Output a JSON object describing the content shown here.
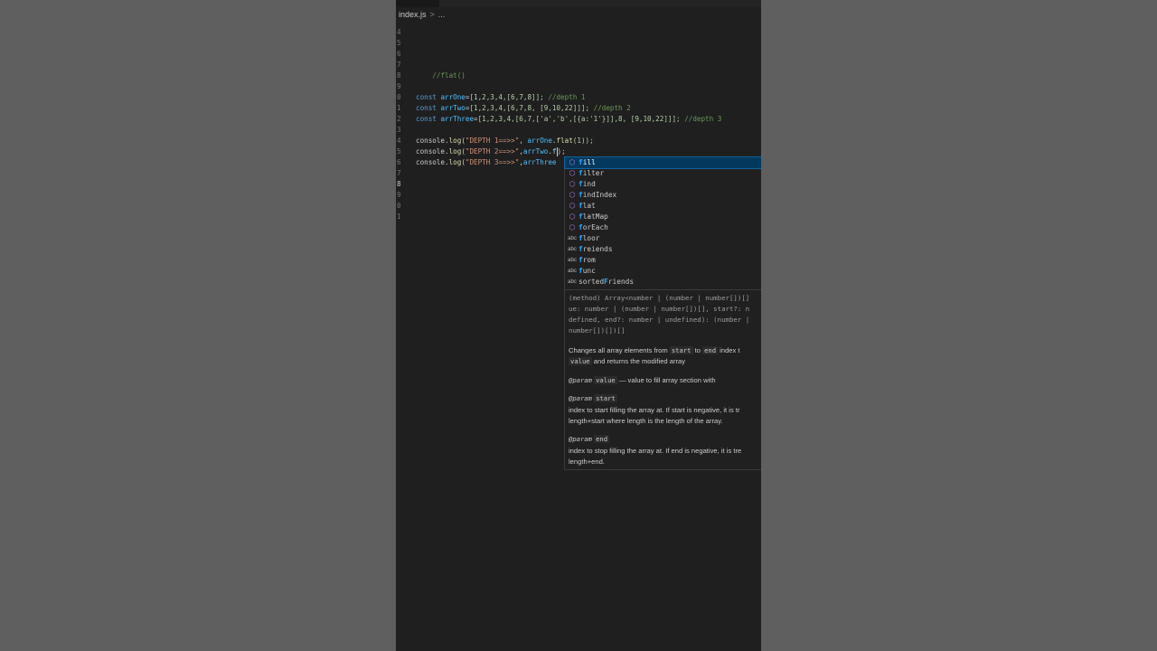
{
  "breadcrumb": {
    "file": "index.js",
    "separator": ">",
    "more": "..."
  },
  "line_numbers": [
    "4",
    "5",
    "6",
    "7",
    "8",
    "9",
    "0",
    "1",
    "2",
    "3",
    "4",
    "5",
    "6",
    "7",
    "8",
    "9",
    "0",
    "1"
  ],
  "active_line_index": 14,
  "code": {
    "l8_comment": "//flat()",
    "l11": {
      "kw": "const",
      "var": "arrOne",
      "eq": "=",
      "value": "[1,2,3,4,[6,7,8]];",
      "comment": "//depth 1"
    },
    "l12": {
      "kw": "const",
      "var": "arrTwo",
      "eq": "=",
      "value": "[1,2,3,4,[6,7,8, [9,10,22]]];",
      "comment": "//depth 2"
    },
    "l13": {
      "kw": "const",
      "var": "arrThree",
      "eq": "=",
      "value": "[1,2,3,4,[6,7,['a','b',[{a:'1'}]],8, [9,10,22]]];",
      "comment": "//depth 3"
    },
    "l15": {
      "obj": "console",
      "dot": ".",
      "fn": "log",
      "open": "(",
      "str": "\"DEPTH 1==>>\"",
      "sep": ", ",
      "target": "arrOne",
      "dot2": ".",
      "method": "flat",
      "args": "(1));"
    },
    "l16": {
      "obj": "console",
      "dot": ".",
      "fn": "log",
      "open": "(",
      "str": "\"DEPTH 2==>>\"",
      "sep": ",",
      "target": "arrTwo",
      "dot2": ".",
      "typed": "f",
      "close": ");"
    },
    "l17": {
      "obj": "console",
      "dot": ".",
      "fn": "log",
      "open": "(",
      "str": "\"DEPTH 3==>>\"",
      "sep": ",",
      "target": "arrThree"
    }
  },
  "suggestions": [
    {
      "label_match": "f",
      "label_rest": "ill",
      "kind": "method",
      "icon": "cube-method-icon",
      "selected": true
    },
    {
      "label_match": "f",
      "label_rest": "ilter",
      "kind": "method",
      "icon": "cube-method-icon",
      "selected": false
    },
    {
      "label_match": "f",
      "label_rest": "ind",
      "kind": "method",
      "icon": "cube-method-icon",
      "selected": false
    },
    {
      "label_match": "f",
      "label_rest": "indIndex",
      "kind": "method",
      "icon": "cube-method-icon",
      "selected": false
    },
    {
      "label_match": "f",
      "label_rest": "lat",
      "kind": "method",
      "icon": "cube-method-icon",
      "selected": false
    },
    {
      "label_match": "f",
      "label_rest": "latMap",
      "kind": "method",
      "icon": "cube-method-icon",
      "selected": false
    },
    {
      "label_match": "f",
      "label_rest": "orEach",
      "kind": "method",
      "icon": "cube-method-icon",
      "selected": false
    },
    {
      "label_match": "f",
      "label_rest": "loor",
      "kind": "word",
      "icon": "abc-text-icon",
      "selected": false
    },
    {
      "label_match": "f",
      "label_rest": "reiends",
      "kind": "word",
      "icon": "abc-text-icon",
      "selected": false
    },
    {
      "label_match": "f",
      "label_rest": "rom",
      "kind": "word",
      "icon": "abc-text-icon",
      "selected": false
    },
    {
      "label_match": "f",
      "label_rest": "unc",
      "kind": "word",
      "icon": "abc-text-icon",
      "selected": false
    },
    {
      "label_prefix": "sorted",
      "label_match": "F",
      "label_rest": "riends",
      "kind": "word",
      "icon": "abc-text-icon",
      "selected": false
    }
  ],
  "word_icon_text": "abc",
  "method_icon_glyph": "⬡",
  "doc": {
    "signature": [
      "(method) Array<number | (number | number[])[]",
      "ue: number | (number | number[])[], start?: n",
      "defined, end?: number | undefined): (number |",
      "number[])[])[]"
    ],
    "desc_pre": "Changes all array elements from ",
    "desc_start": "start",
    "desc_to": " to ",
    "desc_end": "end",
    "desc_post": " index t",
    "desc2_value": "value",
    "desc2_post": " and returns the modified array",
    "param_tag": "@param",
    "param1_name": "value",
    "param1_desc": " — value to fill array section with",
    "param2_name": "start",
    "param2_line1": "index to start filling the array at. If start is negative, it is tr",
    "param2_line2": "length+start where length is the length of the array.",
    "param3_name": "end",
    "param3_line1": "index to stop filling the array at. If end is negative, it is tre",
    "param3_line2": "length+end."
  }
}
